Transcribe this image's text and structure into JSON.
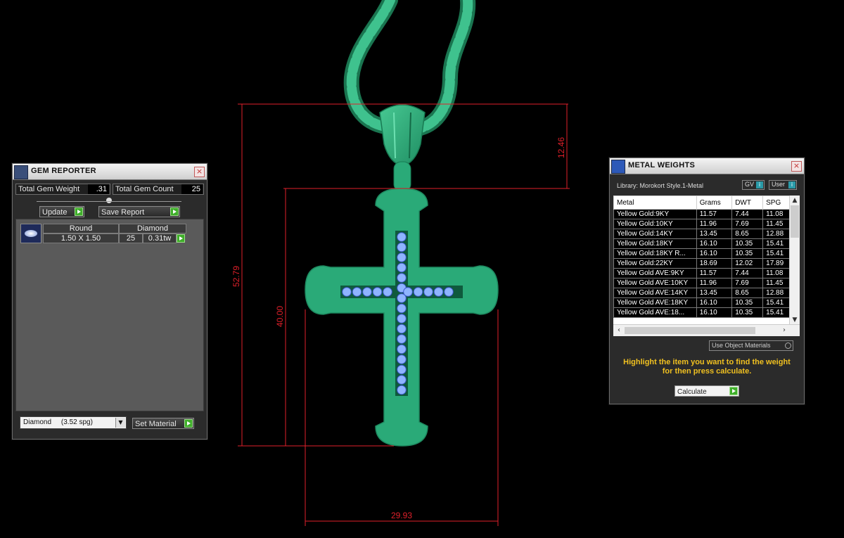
{
  "viewport": {
    "model_color": "#2aaa78",
    "gem_color": "#8fb4ff",
    "dimension_color": "#e0202a",
    "dimensions": {
      "overall_height": "52.79",
      "cross_height": "40.00",
      "bail_height": "12.46",
      "width": "29.93"
    }
  },
  "gem_reporter": {
    "title": "GEM REPORTER",
    "icon": "gem-report-icon",
    "total_weight_label": "Total Gem Weight",
    "total_weight_value": ".31",
    "total_count_label": "Total Gem Count",
    "total_count_value": "25",
    "update_label": "Update",
    "save_report_label": "Save Report",
    "gem": {
      "cut": "Round",
      "material": "Diamond",
      "size": "1.50 X 1.50",
      "count": "25",
      "weight": "0.31tw"
    },
    "material_select": "Diamond     (3.52 spg)",
    "set_material_label": "Set Material"
  },
  "metal_weights": {
    "title": "METAL WEIGHTS",
    "icon": "metal-weights-icon",
    "library_text": "Library: Morokort Style.1-Metal",
    "gv_label": "GV",
    "user_label": "User",
    "columns": [
      "Metal",
      "Grams",
      "DWT",
      "SPG"
    ],
    "rows": [
      [
        "Yellow Gold:9KY",
        "11.57",
        "7.44",
        "11.08"
      ],
      [
        "Yellow Gold:10KY",
        "11.96",
        "7.69",
        "11.45"
      ],
      [
        "Yellow Gold:14KY",
        "13.45",
        "8.65",
        "12.88"
      ],
      [
        "Yellow Gold:18KY",
        "16.10",
        "10.35",
        "15.41"
      ],
      [
        "Yellow Gold:18KY R...",
        "16.10",
        "10.35",
        "15.41"
      ],
      [
        "Yellow Gold:22KY",
        "18.69",
        "12.02",
        "17.89"
      ],
      [
        "Yellow Gold AVE:9KY",
        "11.57",
        "7.44",
        "11.08"
      ],
      [
        "Yellow Gold AVE:10KY",
        "11.96",
        "7.69",
        "11.45"
      ],
      [
        "Yellow Gold AVE:14KY",
        "13.45",
        "8.65",
        "12.88"
      ],
      [
        "Yellow Gold AVE:18KY",
        "16.10",
        "10.35",
        "15.41"
      ],
      [
        "Yellow Gold AVE:18...",
        "16.10",
        "10.35",
        "15.41"
      ]
    ],
    "use_object_materials_label": "Use Object Materials",
    "hint_line1": "Highlight the item you want to find the weight",
    "hint_line2": "for then press calculate.",
    "hint_color": "#f0c020",
    "calculate_label": "Calculate"
  }
}
